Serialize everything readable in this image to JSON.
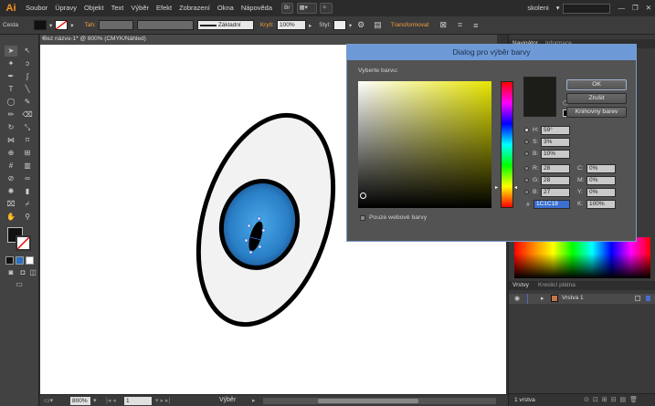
{
  "app": {
    "logo": "Ai"
  },
  "menubar": {
    "items": [
      "Soubor",
      "Úpravy",
      "Objekt",
      "Text",
      "Výběr",
      "Efekt",
      "Zobrazení",
      "Okna",
      "Nápověda"
    ],
    "br_label": "Br",
    "workspace": "skoleni",
    "search_icon": "search-icon"
  },
  "controlbar": {
    "selection_label": "Cesta",
    "stroke_label": "Tah:",
    "stroke_style": "Základní",
    "opacity_label": "Krytí:",
    "opacity_value": "100%",
    "style_label": "Styl:",
    "transform_label": "Transformovat"
  },
  "document": {
    "tab_title": "Bez názvu-1* @ 800% (CMYK/Náhled)",
    "zoom": "800%",
    "artboard": "1",
    "status": "Výběr"
  },
  "right_panel": {
    "tabs_top": [
      "Navigátor",
      "Informace"
    ],
    "layers_tabs": [
      "Vrstvy",
      "Kreslicí plátna"
    ],
    "layer_name": "Vrstva 1",
    "footer_text": "1 vrstva"
  },
  "dialog": {
    "title": "Dialog pro výběr barvy",
    "pick_label": "Vyberte barvu:",
    "ok": "OK",
    "cancel": "Zrušit",
    "libraries": "Knihovny barev",
    "web_only": "Pouze webové barvy",
    "fields": {
      "H": "59°",
      "S": "3%",
      "B": "10%",
      "R": "28",
      "G": "28",
      "Bb": "27",
      "hex": "1C1C18",
      "C": "0%",
      "M": "0%",
      "Y": "0%",
      "K": "100%"
    },
    "labels": {
      "H": "H:",
      "S": "S:",
      "B": "B:",
      "R": "R:",
      "G": "G:",
      "Bb": "B:",
      "hex": "#",
      "C": "C:",
      "M": "M:",
      "Y": "Y:",
      "K": "K:"
    },
    "base_hue_color": "#e8e600",
    "current_color": "#1c1c18"
  }
}
